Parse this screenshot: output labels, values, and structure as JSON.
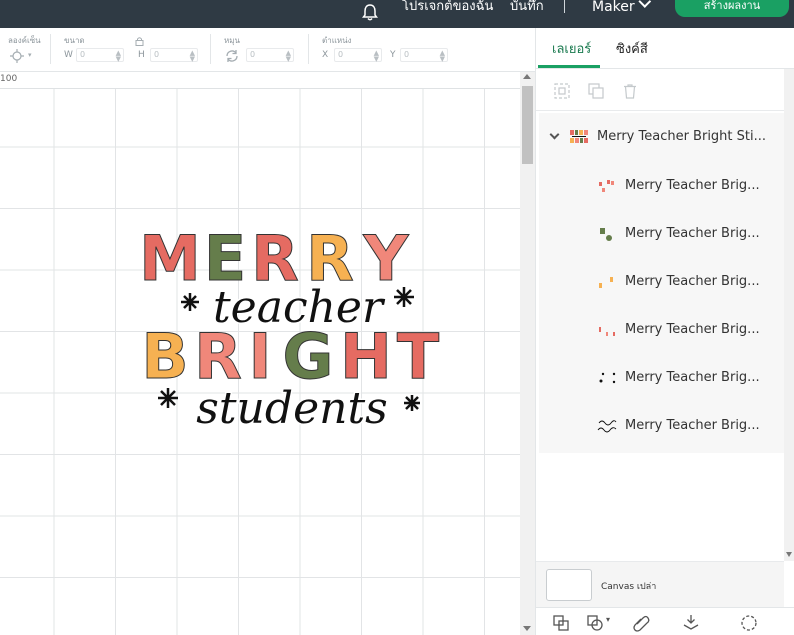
{
  "header": {
    "projects_label": "โปรเจกต์ของฉัน",
    "save_label": "บันทึก",
    "separator": "|",
    "machine_label": "Maker",
    "make_button": "สร้างผลงาน"
  },
  "toolbar": {
    "align_label": "ลองค์เซ็น",
    "size_label": "ขนาด",
    "rotate_label": "หมุน",
    "position_label": "ตำแหน่ง",
    "w_letter": "W",
    "h_letter": "H",
    "x_letter": "X",
    "y_letter": "Y",
    "w_value": "0",
    "h_value": "0",
    "rotate_value": "0",
    "x_value": "0",
    "y_value": "0"
  },
  "ruler": {
    "label": "100"
  },
  "design": {
    "line1": "MERRY",
    "line2": "teacher",
    "line3": "BRIGHT",
    "line4": "students"
  },
  "panel": {
    "tabs": [
      {
        "label": "เลเยอร์",
        "active": true
      },
      {
        "label": "ซิงค์สี",
        "active": false
      }
    ],
    "group": {
      "name": "Merry Teacher Bright Sti..."
    },
    "layers": [
      {
        "name": "Merry Teacher Brig...",
        "icon": "red-letters-icon"
      },
      {
        "name": "Merry Teacher Brig...",
        "icon": "green-letters-icon"
      },
      {
        "name": "Merry Teacher Brig...",
        "icon": "orange-letters-icon"
      },
      {
        "name": "Merry Teacher Brig...",
        "icon": "pink-letters-icon"
      },
      {
        "name": "Merry Teacher Brig...",
        "icon": "snowflake-icon"
      },
      {
        "name": "Merry Teacher Brig...",
        "icon": "script-text-icon"
      }
    ],
    "canvas_label": "Canvas เปล่า"
  },
  "colors": {
    "header_bg": "#2f3a44",
    "accent_green": "#1aa063",
    "merry_red": "#e56b62",
    "merry_green": "#657d4b",
    "merry_pink": "#f0877a",
    "merry_orange": "#f6b152"
  }
}
